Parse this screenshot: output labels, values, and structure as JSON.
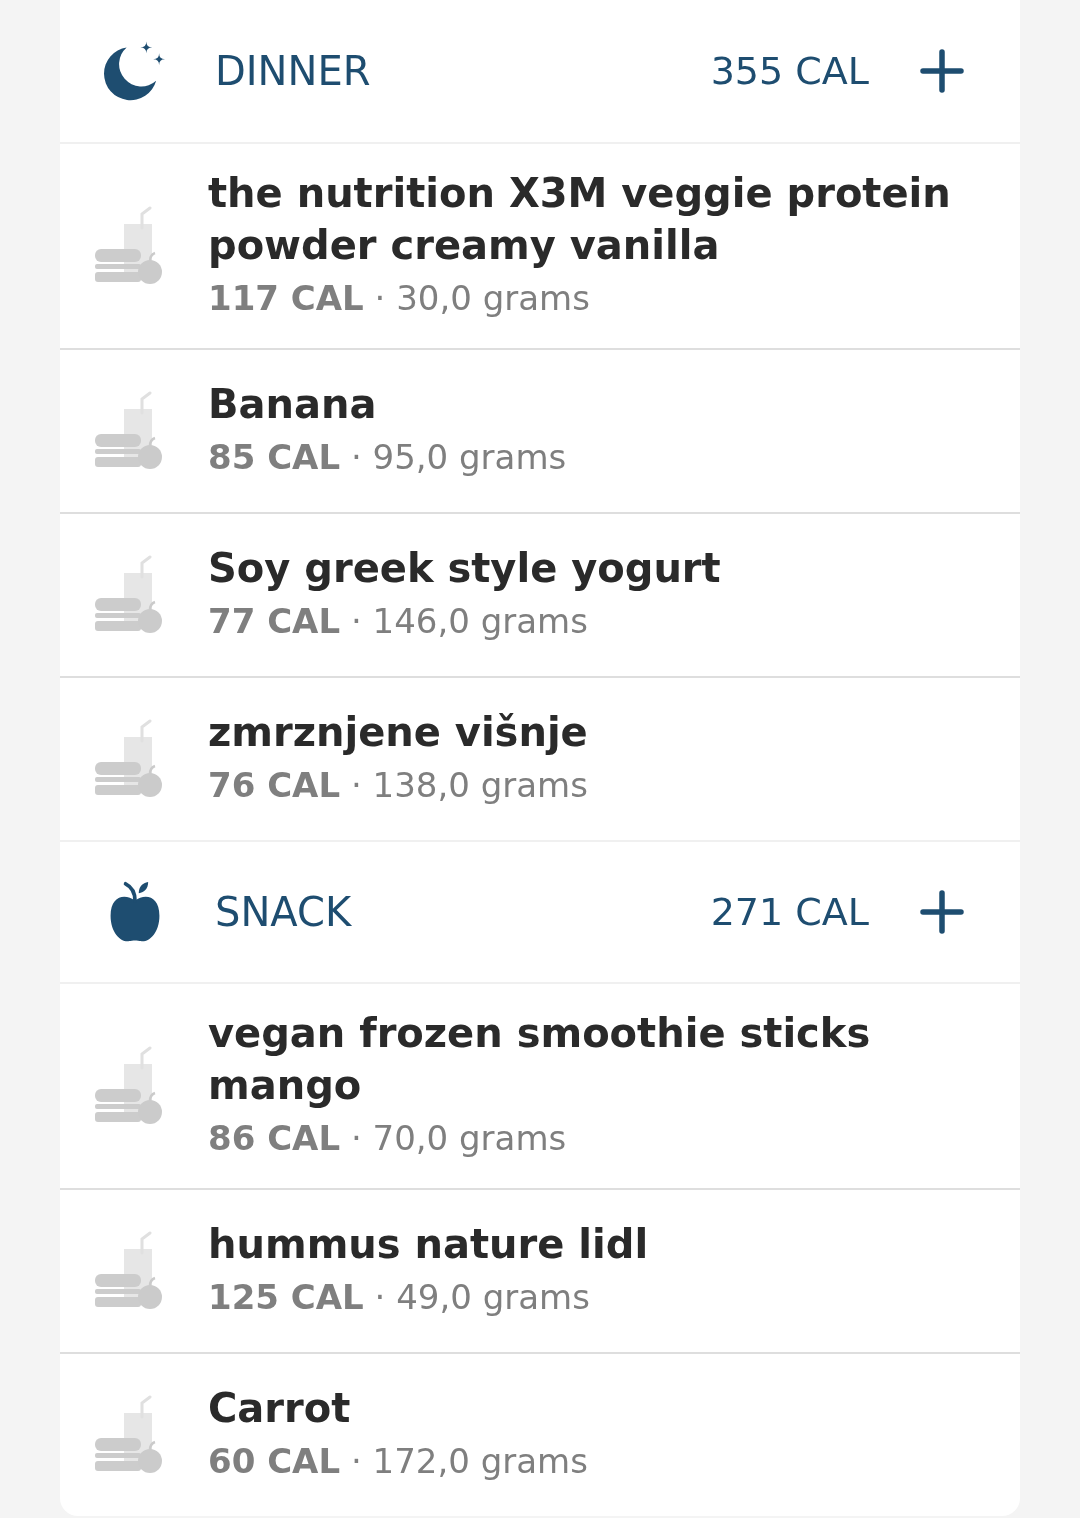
{
  "meals": [
    {
      "kind": "dinner",
      "name": "DINNER",
      "calories": "355 CAL",
      "foods": [
        {
          "name": "the nutrition X3M veggie protein powder creamy vanilla",
          "details": "**117 CAL** · 30,0 grams"
        },
        {
          "name": "Banana",
          "details": "**85 CAL** · 95,0 grams"
        },
        {
          "name": "Soy greek style yogurt",
          "details": "**77 CAL** · 146,0 grams"
        },
        {
          "name": "zmrznjene višnje",
          "details": "**76 CAL** · 138,0 grams"
        }
      ]
    },
    {
      "kind": "snack",
      "name": "SNACK",
      "calories": "271 CAL",
      "foods": [
        {
          "name": "vegan frozen smoothie sticks mango",
          "details": "**86 CAL** · 70,0 grams"
        },
        {
          "name": "hummus nature lidl",
          "details": "**125 CAL** · 49,0 grams"
        },
        {
          "name": "Carrot",
          "details": "**60 CAL** · 172,0 grams"
        }
      ]
    }
  ]
}
